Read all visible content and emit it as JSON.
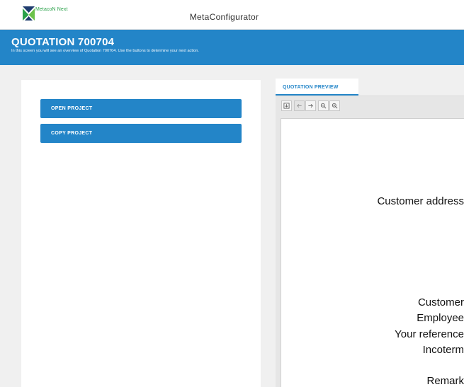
{
  "app": {
    "logo_text": "MetacoN Next",
    "title": "MetaConfigurator"
  },
  "header": {
    "title": "QUOTATION 700704",
    "subtitle": "In this screen you will see an overview of Quotation 700704. Use the buttons to determine your next action."
  },
  "actions": {
    "open_project": "OPEN PROJECT",
    "copy_project": "COPY PROJECT"
  },
  "preview": {
    "tab_label": "QUOTATION PREVIEW",
    "toolbar_icons": [
      "download-icon",
      "arrow-left-icon",
      "arrow-right-icon",
      "zoom-out-icon",
      "zoom-in-icon"
    ],
    "document_lines": {
      "customer_address": "Customer address",
      "customer": "Customer",
      "employee": "Employee",
      "your_reference": "Your reference",
      "incoterm": "Incoterm",
      "remark": "Remark"
    }
  },
  "colors": {
    "brand_blue": "#2385c8",
    "logo_green": "#2aa14a",
    "logo_navy": "#1f3c6e"
  }
}
